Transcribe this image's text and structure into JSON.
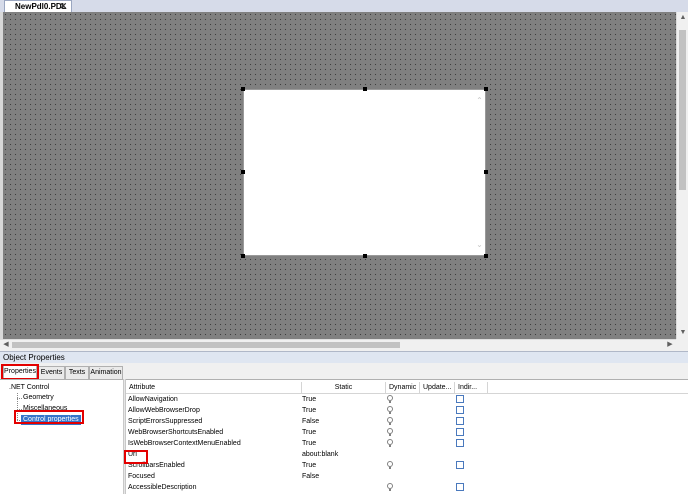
{
  "document_tab": {
    "title": "NewPdl0.PDL",
    "close_label": "✕"
  },
  "panel_title": "Object Properties",
  "tabs": [
    {
      "label": "Properties",
      "active": true
    },
    {
      "label": "Events",
      "active": false
    },
    {
      "label": "Texts",
      "active": false
    },
    {
      "label": "Animation",
      "active": false
    }
  ],
  "tree": {
    "root": ".NET Control",
    "children": [
      "Geometry",
      "Miscellaneous",
      "Control properties"
    ],
    "selected": "Control properties"
  },
  "grid": {
    "columns": [
      "Attribute",
      "Static",
      "Dynamic",
      "Update...",
      "Indir..."
    ],
    "rows": [
      {
        "attribute": "AllowNavigation",
        "static": "True",
        "dynamic": true,
        "indirect": true
      },
      {
        "attribute": "AllowWebBrowserDrop",
        "static": "True",
        "dynamic": true,
        "indirect": true
      },
      {
        "attribute": "ScriptErrorsSuppressed",
        "static": "False",
        "dynamic": true,
        "indirect": true
      },
      {
        "attribute": "WebBrowserShortcutsEnabled",
        "static": "True",
        "dynamic": true,
        "indirect": true
      },
      {
        "attribute": "IsWebBrowserContextMenuEnabled",
        "static": "True",
        "dynamic": true,
        "indirect": true
      },
      {
        "attribute": "Url",
        "static": "about:blank",
        "dynamic": false,
        "indirect": false
      },
      {
        "attribute": "ScrollbarsEnabled",
        "static": "True",
        "dynamic": true,
        "indirect": true
      },
      {
        "attribute": "Focused",
        "static": "False",
        "dynamic": false,
        "indirect": false
      },
      {
        "attribute": "AccessibleDescription",
        "static": "",
        "dynamic": true,
        "indirect": true
      }
    ]
  },
  "icons": {
    "scroll_up": "▲",
    "scroll_down": "▼",
    "scroll_left": "◀",
    "scroll_right": "▶",
    "chevron_up": "⌃",
    "chevron_down": "⌄"
  },
  "colors": {
    "canvas": "#808080",
    "selection": "#3574c9",
    "highlight_box": "#e30000"
  }
}
